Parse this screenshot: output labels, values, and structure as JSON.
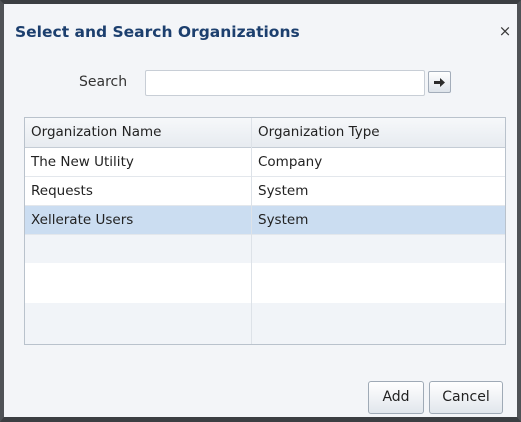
{
  "dialog": {
    "title": "Select and Search Organizations",
    "close_label": "×"
  },
  "search": {
    "label": "Search",
    "value": "",
    "placeholder": "",
    "go_icon": "arrow-right-icon"
  },
  "table": {
    "columns": [
      "Organization Name",
      "Organization Type"
    ],
    "rows": [
      {
        "name": "The New Utility",
        "type": "Company",
        "selected": false
      },
      {
        "name": "Requests",
        "type": "System",
        "selected": false
      },
      {
        "name": "Xellerate Users",
        "type": "System",
        "selected": true
      }
    ]
  },
  "buttons": {
    "add_label": "Add",
    "cancel_label": "Cancel"
  },
  "colors": {
    "title": "#1c3f6e",
    "selected_row": "#cbddf1",
    "dialog_bg": "#f3f5f8"
  }
}
